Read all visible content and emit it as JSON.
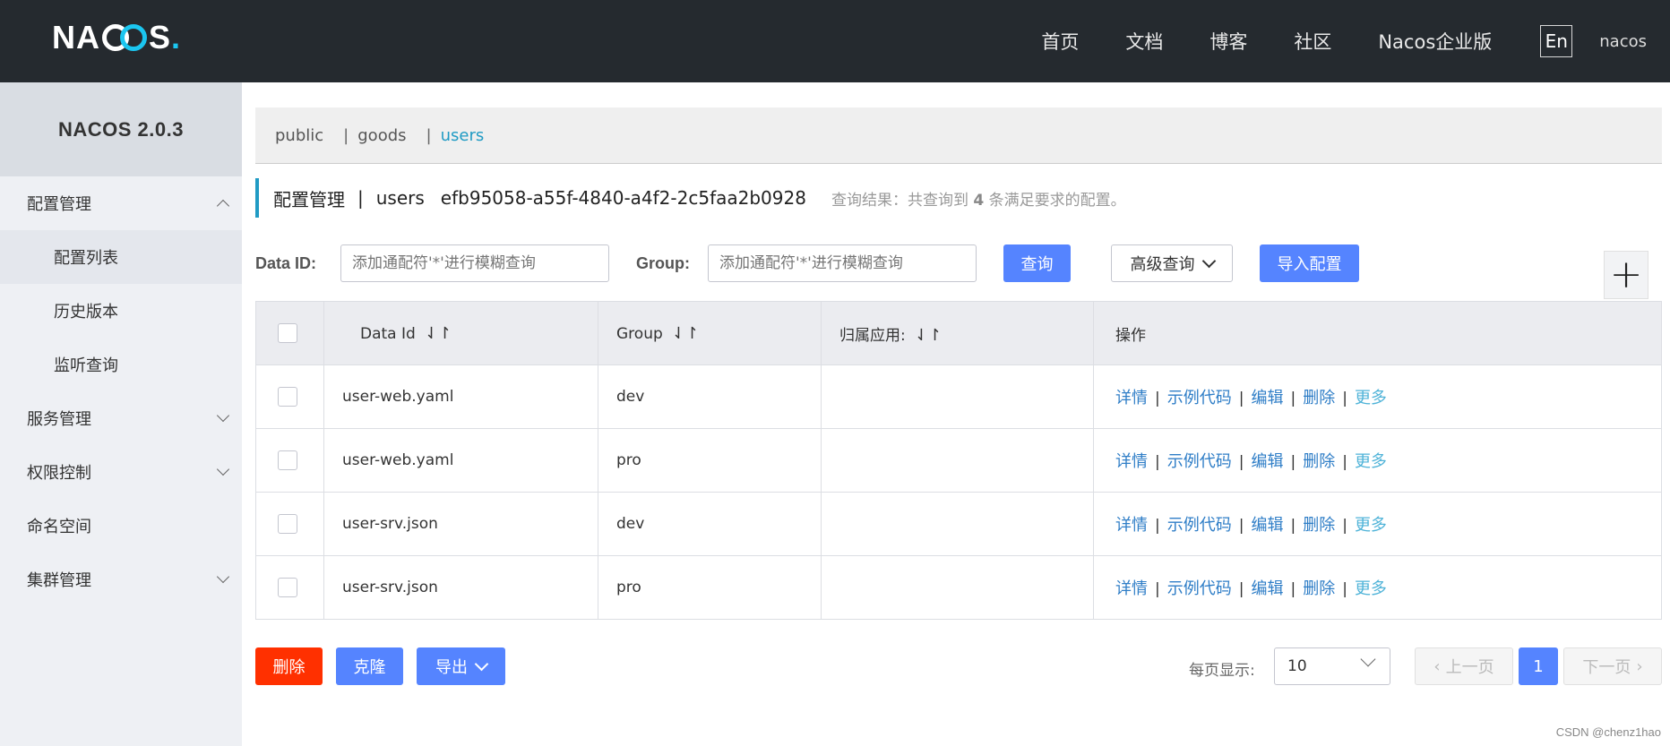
{
  "topnav": {
    "logo_text_left": "NA",
    "logo_text_right": "S",
    "logo_dot": ".",
    "items": [
      "首页",
      "文档",
      "博客",
      "社区",
      "Nacos企业版"
    ],
    "lang": "En",
    "user": "nacos"
  },
  "sidebar": {
    "title": "NACOS 2.0.3",
    "items": [
      {
        "label": "配置管理",
        "chevron": "up"
      },
      {
        "label": "配置列表"
      },
      {
        "label": "历史版本"
      },
      {
        "label": "监听查询"
      },
      {
        "label": "服务管理",
        "chevron": "down"
      },
      {
        "label": "权限控制",
        "chevron": "down"
      },
      {
        "label": "命名空间"
      },
      {
        "label": "集群管理",
        "chevron": "down"
      }
    ]
  },
  "namespaces": {
    "items": [
      "public",
      "goods",
      "users"
    ],
    "active": "users"
  },
  "title": {
    "section": "配置管理",
    "namespace": "users",
    "namespace_id": "efb95058-a55f-4840-a4f2-2c5faa2b0928",
    "result_prefix": "查询结果：共查询到",
    "result_count": "4",
    "result_suffix": "条满足要求的配置。"
  },
  "search": {
    "data_id_label": "Data ID:",
    "data_id_placeholder": "添加通配符'*'进行模糊查询",
    "group_label": "Group:",
    "group_placeholder": "添加通配符'*'进行模糊查询",
    "query_button": "查询",
    "advanced_button": "高级查询",
    "import_button": "导入配置",
    "add_button": "+"
  },
  "table": {
    "headers": [
      "Data Id",
      "Group",
      "归属应用:",
      "操作"
    ],
    "sort_icon": "⇃↾",
    "rows": [
      {
        "data_id": "user-web.yaml",
        "group": "dev",
        "app": ""
      },
      {
        "data_id": "user-web.yaml",
        "group": "pro",
        "app": ""
      },
      {
        "data_id": "user-srv.json",
        "group": "dev",
        "app": ""
      },
      {
        "data_id": "user-srv.json",
        "group": "pro",
        "app": ""
      }
    ],
    "ops": [
      "详情",
      "示例代码",
      "编辑",
      "删除",
      "更多"
    ]
  },
  "footer": {
    "delete_button": "删除",
    "clone_button": "克隆",
    "export_button": "导出",
    "page_size_label": "每页显示:",
    "page_size": "10",
    "prev_button": "上一页",
    "current_page": "1",
    "next_button": "下一页"
  },
  "watermark": "CSDN @chenz1hao",
  "colors": {
    "primary": "#5584ff",
    "danger": "#ff3000",
    "accent": "#209bc4",
    "topnav_bg": "#252a2f"
  }
}
